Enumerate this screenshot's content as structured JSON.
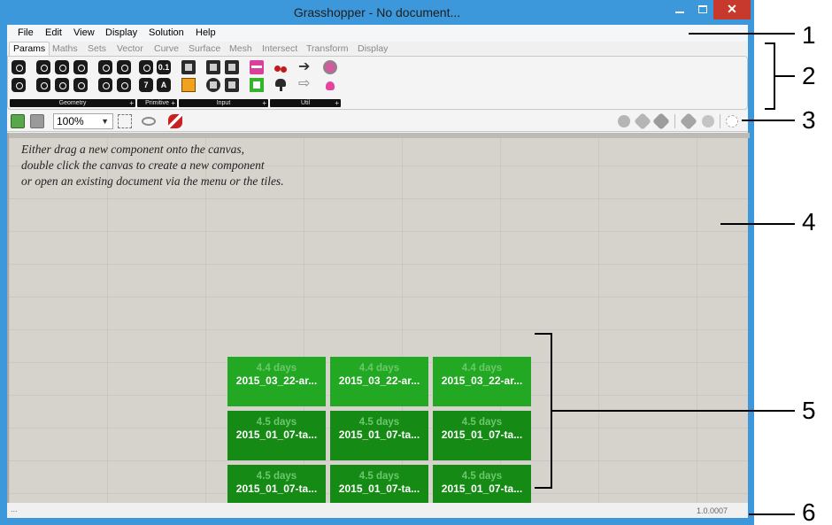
{
  "window": {
    "title": "Grasshopper - No document...",
    "close_glyph": "✕"
  },
  "menu": [
    "File",
    "Edit",
    "View",
    "Display",
    "Solution",
    "Help"
  ],
  "tabs": [
    "Params",
    "Maths",
    "Sets",
    "Vector",
    "Curve",
    "Surface",
    "Mesh",
    "Intersect",
    "Transform",
    "Display"
  ],
  "active_tab": "Params",
  "ribbon_groups": [
    {
      "label": "Geometry",
      "plus": "+"
    },
    {
      "label": "Primitive",
      "plus": "+"
    },
    {
      "label": "Input",
      "plus": "+"
    },
    {
      "label": "Util",
      "plus": "+"
    }
  ],
  "primitive_icons": [
    "0.1",
    "7",
    "A"
  ],
  "toolbar": {
    "zoom": "100%",
    "caret": "⌵"
  },
  "canvas_hint": [
    "Either drag a new component onto the canvas,",
    "double click the canvas to create a new component",
    "or open an existing document via the menu or the tiles."
  ],
  "tiles": [
    {
      "age": "4.4 days",
      "name": "2015_03_22-ar..."
    },
    {
      "age": "4.4 days",
      "name": "2015_03_22-ar..."
    },
    {
      "age": "4.4 days",
      "name": "2015_03_22-ar..."
    },
    {
      "age": "4.5 days",
      "name": "2015_01_07-ta..."
    },
    {
      "age": "4.5 days",
      "name": "2015_01_07-ta..."
    },
    {
      "age": "4.5 days",
      "name": "2015_01_07-ta..."
    },
    {
      "age": "4.5 days",
      "name": "2015_01_07-ta..."
    },
    {
      "age": "4.5 days",
      "name": "2015_01_07-ta..."
    },
    {
      "age": "4.5 days",
      "name": "2015_01_07-ta..."
    }
  ],
  "status": {
    "left": "...",
    "version": "1.0.0007"
  },
  "annotations": [
    "1",
    "2",
    "3",
    "4",
    "5",
    "6"
  ],
  "colors": {
    "frame": "#3c98db",
    "close_button": "#c7392c",
    "canvas": "#d6d3cd",
    "tile_recent": "#22a822",
    "tile_older": "#158a15"
  }
}
